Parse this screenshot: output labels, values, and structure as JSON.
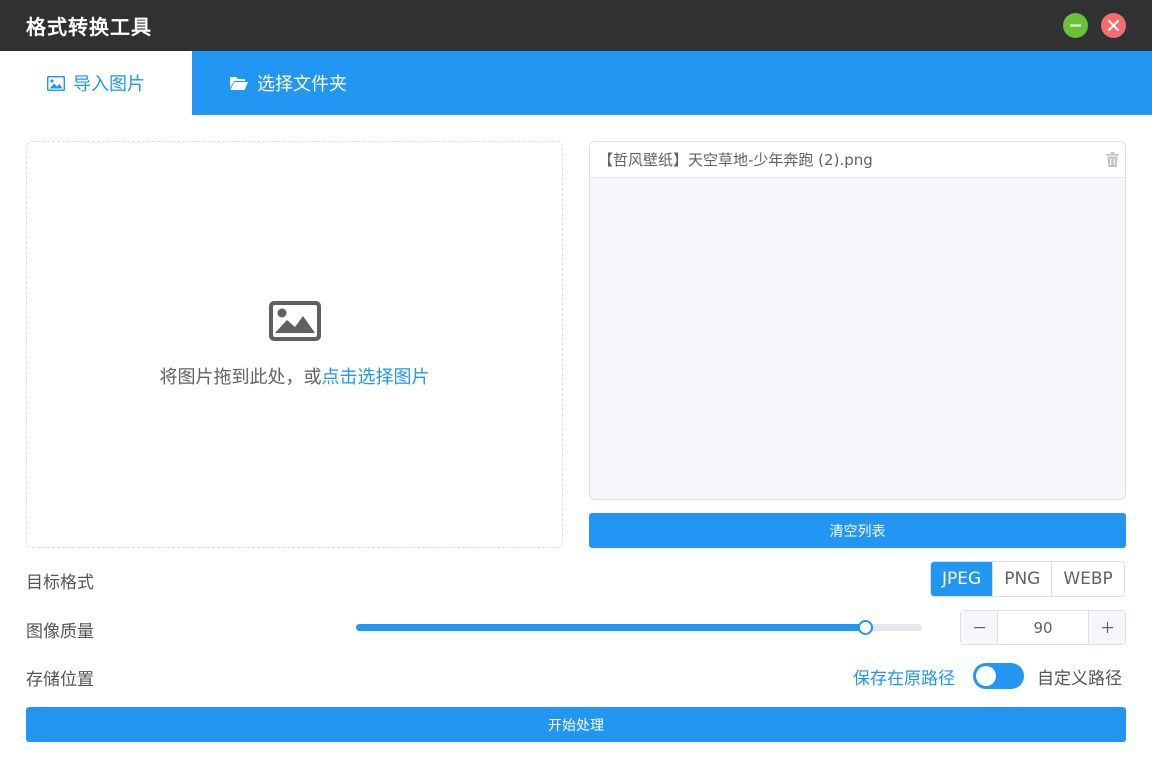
{
  "app": {
    "title": "格式转换工具"
  },
  "window": {
    "minimize": "minimize-icon",
    "close": "close-icon"
  },
  "tabs": [
    {
      "label": "导入图片",
      "icon": "image-icon",
      "active": true
    },
    {
      "label": "选择文件夹",
      "icon": "folder-open-icon",
      "active": false
    }
  ],
  "dropzone": {
    "text": "将图片拖到此处，或",
    "link": "点击选择图片",
    "icon": "image-icon"
  },
  "file_list": {
    "items": [
      {
        "name": "【哲风壁纸】天空草地-少年奔跑 (2).png",
        "icon": "trash-icon"
      }
    ],
    "clear_label": "清空列表"
  },
  "settings": {
    "format_label": "目标格式",
    "formats": [
      "JPEG",
      "PNG",
      "WEBP"
    ],
    "selected_format": "JPEG",
    "quality_label": "图像质量",
    "quality": 90,
    "quality_min": 0,
    "quality_max": 100,
    "storage_label": "存储位置",
    "save_original": "保存在原路径",
    "save_custom": "自定义路径"
  },
  "start_label": "开始处理",
  "colors": {
    "primary": "#2196f3",
    "titlebar": "#303133",
    "minimize": "#67c23a",
    "close": "#f56c6c"
  }
}
